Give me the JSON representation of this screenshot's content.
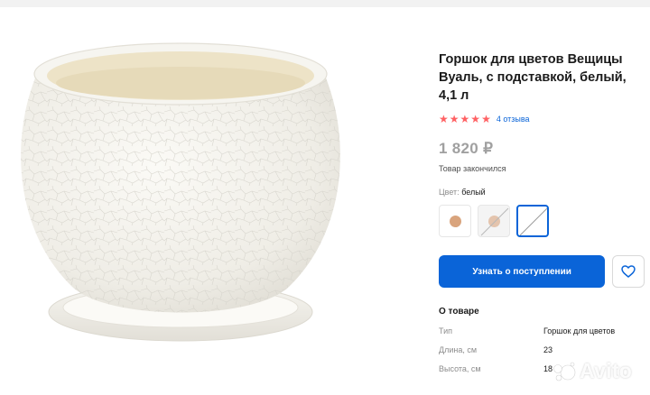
{
  "product": {
    "title": "Горшок для цветов Вещицы Вуаль, с подставкой, белый, 4,1 л",
    "rating": 5,
    "reviews_link": "4 отзыва",
    "price": "1 820 ₽",
    "stock_status": "Товар закончился",
    "color_label": "Цвет:",
    "color_value": "белый"
  },
  "swatches": [
    {
      "name": "terracotta",
      "color": "#d9a47d",
      "available": true,
      "selected": false
    },
    {
      "name": "terracotta-unavailable",
      "color": "#d9a47d",
      "available": false,
      "selected": false
    },
    {
      "name": "white-selected",
      "color": "#ffffff",
      "available": false,
      "selected": true
    }
  ],
  "actions": {
    "notify_label": "Узнать о поступлении"
  },
  "about": {
    "heading": "О товаре",
    "specs": [
      {
        "key": "Тип",
        "value": "Горшок для цветов"
      },
      {
        "key": "Длина, см",
        "value": "23"
      },
      {
        "key": "Высота, см",
        "value": "18"
      }
    ]
  },
  "watermark": "Avito",
  "colors": {
    "accent": "#0a64d8",
    "star": "#ff6163",
    "price_muted": "#a0a0a0"
  }
}
